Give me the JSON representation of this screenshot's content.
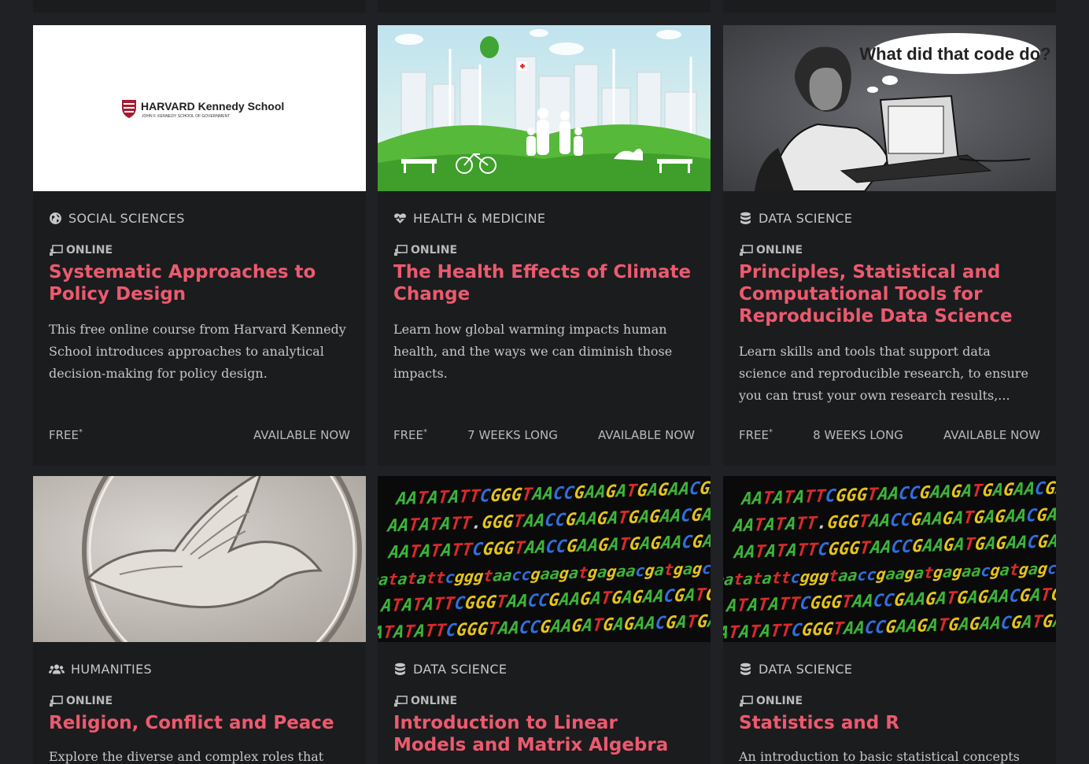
{
  "cards": [
    {
      "category": "SOCIAL SCIENCES",
      "category_icon": "globe-icon",
      "mode": "ONLINE",
      "title": "Systematic Approaches to Policy Design",
      "description": "This free online course from Harvard Kennedy School introduces approaches to analytical decision-making for policy design.",
      "price": "FREE",
      "price_mark": "*",
      "duration": "",
      "availability": "AVAILABLE NOW",
      "image": "harvard-kennedy-school-logo",
      "logo_text": {
        "main": "HARVARD Kennedy School",
        "sub": "JOHN F. KENNEDY SCHOOL OF GOVERNMENT"
      }
    },
    {
      "category": "HEALTH & MEDICINE",
      "category_icon": "heartbeat-icon",
      "mode": "ONLINE",
      "title": "The Health Effects of Climate Change",
      "description": "Learn how global warming impacts human health, and the ways we can diminish those impacts.",
      "price": "FREE",
      "price_mark": "*",
      "duration": "7 WEEKS LONG",
      "availability": "AVAILABLE NOW",
      "image": "green-city-family-illustration"
    },
    {
      "category": "DATA SCIENCE",
      "category_icon": "database-icon",
      "mode": "ONLINE",
      "title": "Principles, Statistical and Computational Tools for Reproducible Data Science",
      "description": "Learn skills and tools that support data science and reproducible research, to ensure you can trust your own research results,...",
      "price": "FREE",
      "price_mark": "*",
      "duration": "8 WEEKS LONG",
      "availability": "AVAILABLE NOW",
      "image": "person-at-laptop-sketch",
      "speech_text": "What did that code do?"
    },
    {
      "category": "HUMANITIES",
      "category_icon": "users-icon",
      "mode": "ONLINE",
      "title": "Religion, Conflict and Peace",
      "description": "Explore the diverse and complex roles that",
      "image": "stone-dove-relief"
    },
    {
      "category": "DATA SCIENCE",
      "category_icon": "database-icon",
      "mode": "ONLINE",
      "title": "Introduction to Linear Models and Matrix Algebra",
      "description": "",
      "image": "dna-sequence-letters"
    },
    {
      "category": "DATA SCIENCE",
      "category_icon": "database-icon",
      "mode": "ONLINE",
      "title": "Statistics and R",
      "description": "An introduction to basic statistical concepts and",
      "image": "dna-sequence-letters"
    }
  ],
  "dna_lines": [
    "AATATATTCGGGTAACCGAAGATGAGAACGATGAGCCCATTGAA",
    "AATATATT.GGGTAACCGAAGATGAGAACGATGAGCCCATTGAA",
    "AATATATTCGGGTAACCGAAGATGAGAACGATGAGCCCATTGAA",
    "aatatattcgggtaaccgaagatgagaacgatgagcccattgaaa",
    "ATATATTCGGGTAACCGAAGATGAGAACGATGAGCCCATTGAAAT",
    "ATATATTCGGGTAACCGAAGATGAGAACGATGAGCCCATTGAAAT"
  ],
  "dna_colors": {
    "A": "#3db33a",
    "T": "#d92a2a",
    "C": "#2f6fe0",
    "G": "#e6c41a"
  },
  "accent": "#ec5a6e"
}
